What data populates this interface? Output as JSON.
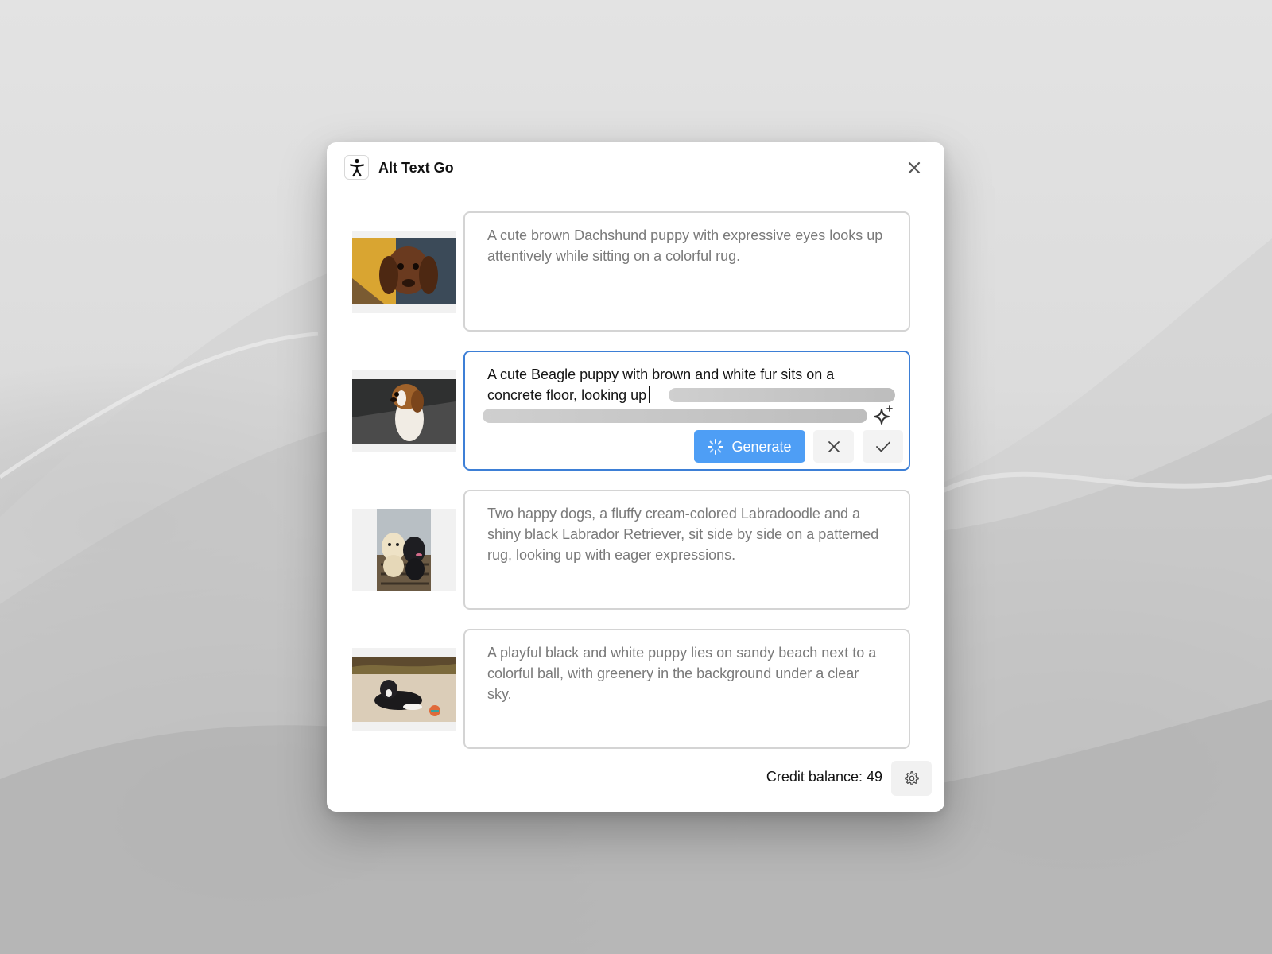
{
  "app": {
    "title": "Alt Text Go"
  },
  "images": [
    {
      "description": "A cute brown Dachshund puppy with expressive eyes looks up attentively while sitting on a colorful rug.",
      "state": "idle"
    },
    {
      "description": "A cute Beagle puppy with brown and white fur sits on a concrete floor, looking up",
      "state": "generating"
    },
    {
      "description": "Two happy dogs, a fluffy cream-colored Labradoodle and a shiny black Labrador Retriever, sit side by side on a patterned rug, looking up with eager expressions.",
      "state": "idle"
    },
    {
      "description": "A playful black and white puppy lies on sandy beach next to a colorful ball, with greenery in the background under a clear sky.",
      "state": "idle"
    }
  ],
  "editor": {
    "generate_label": "Generate"
  },
  "footer": {
    "credit_label": "Credit balance: 49"
  },
  "colors": {
    "accent": "#4e9ef5",
    "active_border": "#3d7fd6"
  }
}
